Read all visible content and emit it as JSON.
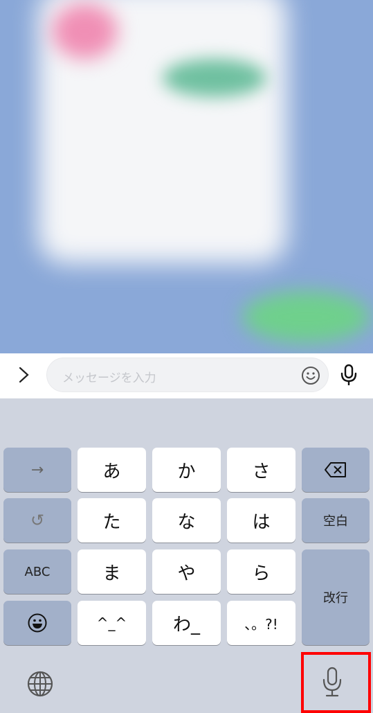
{
  "input_bar": {
    "expand_icon": "chevron-right-icon",
    "placeholder": "メッセージを入力",
    "emoji_icon": "smiley-icon",
    "mic_icon": "microphone-icon"
  },
  "keyboard": {
    "keys": {
      "next": "→",
      "undo": "↺",
      "a": "あ",
      "ka": "か",
      "sa": "さ",
      "delete_icon": "backspace-icon",
      "ta": "た",
      "na": "な",
      "ha": "は",
      "space": "空白",
      "abc": "ABC",
      "ma": "ま",
      "ya": "や",
      "ra": "ら",
      "return": "改行",
      "emoji_icon": "emoji-icon",
      "kaomoji": "^_^",
      "wa": "わ_",
      "punct": "、。?!"
    },
    "globe_icon": "globe-icon",
    "dictation_icon": "microphone-icon"
  },
  "annotation": {
    "highlight_color": "#ff0000",
    "target": "dictation-mic-button"
  },
  "colors": {
    "chat_bg": "#8aa8d8",
    "kb_bg": "#cfd4df",
    "key_gray": "#a2b0c9",
    "key_white": "#ffffff"
  }
}
